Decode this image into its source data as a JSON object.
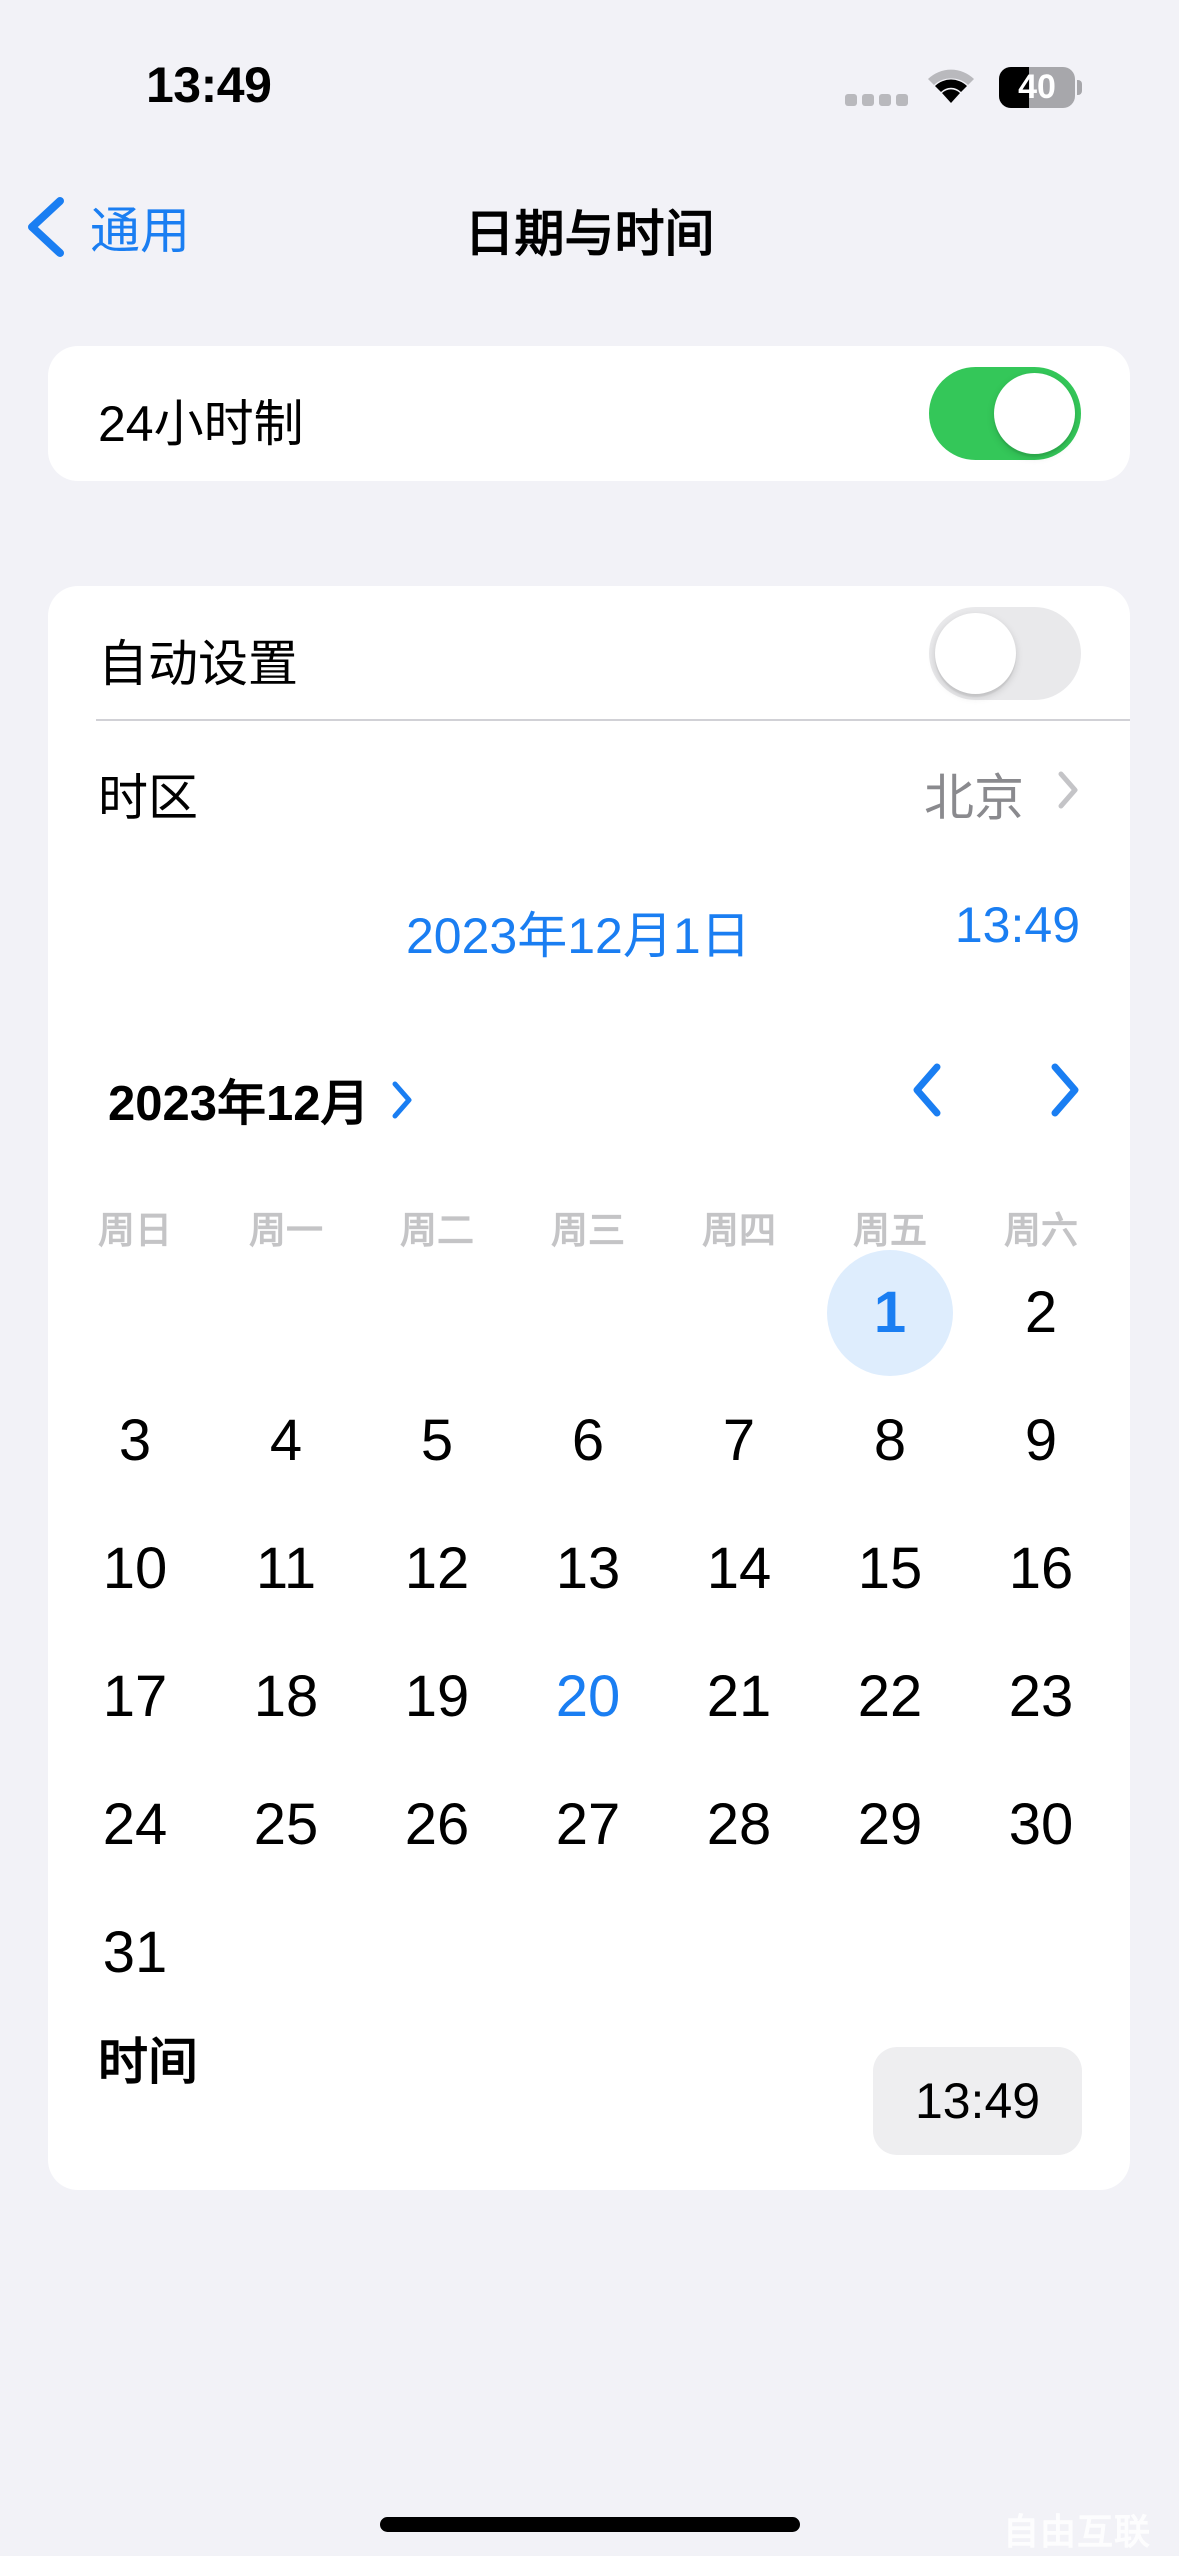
{
  "status_bar": {
    "time": "13:49",
    "battery_level": 40,
    "battery_text": "40",
    "icons": [
      "signal-dots-icon",
      "wifi-icon",
      "battery-icon"
    ]
  },
  "nav": {
    "back_label": "通用",
    "back_icon": "chevron-left-icon",
    "title": "日期与时间"
  },
  "settings": {
    "hour24": {
      "label": "24小时制",
      "enabled": true
    },
    "auto_set": {
      "label": "自动设置",
      "enabled": false
    },
    "timezone": {
      "label": "时区",
      "value": "北京",
      "icon": "chevron-right-icon"
    }
  },
  "date_summary": {
    "date": "2023年12月1日",
    "time": "13:49"
  },
  "calendar": {
    "month_title": "2023年12月",
    "month_expand_icon": "chevron-right-icon",
    "prev_icon": "chevron-left-icon",
    "next_icon": "chevron-right-icon",
    "weekdays": [
      "周日",
      "周一",
      "周二",
      "周三",
      "周四",
      "周五",
      "周六"
    ],
    "first_weekday_index": 5,
    "days_in_month": 31,
    "selected_day": 1,
    "today_day": 20,
    "days": [
      "1",
      "2",
      "3",
      "4",
      "5",
      "6",
      "7",
      "8",
      "9",
      "10",
      "11",
      "12",
      "13",
      "14",
      "15",
      "16",
      "17",
      "18",
      "19",
      "20",
      "21",
      "22",
      "23",
      "24",
      "25",
      "26",
      "27",
      "28",
      "29",
      "30",
      "31"
    ]
  },
  "time_row": {
    "label": "时间",
    "value": "13:49"
  },
  "colors": {
    "accent": "#1a7ef2",
    "toggle_on": "#34c759",
    "toggle_off": "#e9e9eb",
    "background": "#f2f2f7",
    "selected_day_bg": "#deedfd"
  },
  "watermark": "自由互联"
}
